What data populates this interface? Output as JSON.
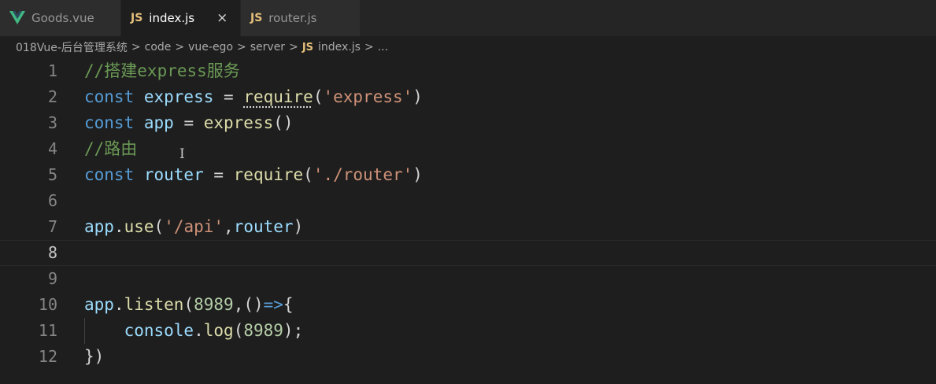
{
  "tabs": [
    {
      "label": "Goods.vue",
      "icon": "vue-icon",
      "active": false
    },
    {
      "label": "index.js",
      "icon": "js-icon",
      "active": true,
      "close": "×"
    },
    {
      "label": "router.js",
      "icon": "js-icon",
      "active": false
    }
  ],
  "js_badge": "JS",
  "breadcrumb": {
    "items": [
      "018Vue-后台管理系统",
      "code",
      "vue-ego",
      "server",
      "index.js",
      "..."
    ],
    "separator": ">"
  },
  "editor": {
    "current_line": 8,
    "lines": [
      {
        "num": "1",
        "tokens": [
          {
            "t": "//搭建express服务",
            "c": "comment"
          }
        ]
      },
      {
        "num": "2",
        "tokens": [
          {
            "t": "const ",
            "c": "keyword"
          },
          {
            "t": "express",
            "c": "var"
          },
          {
            "t": " = ",
            "c": "punct"
          },
          {
            "t": "require",
            "c": "req"
          },
          {
            "t": "(",
            "c": "punct"
          },
          {
            "t": "'express'",
            "c": "str"
          },
          {
            "t": ")",
            "c": "punct"
          }
        ]
      },
      {
        "num": "3",
        "tokens": [
          {
            "t": "const ",
            "c": "keyword"
          },
          {
            "t": "app",
            "c": "var"
          },
          {
            "t": " = ",
            "c": "punct"
          },
          {
            "t": "express",
            "c": "fn"
          },
          {
            "t": "()",
            "c": "punct"
          }
        ]
      },
      {
        "num": "4",
        "tokens": [
          {
            "t": "//路由",
            "c": "comment"
          }
        ]
      },
      {
        "num": "5",
        "tokens": [
          {
            "t": "const ",
            "c": "keyword"
          },
          {
            "t": "router",
            "c": "var"
          },
          {
            "t": " = ",
            "c": "punct"
          },
          {
            "t": "require",
            "c": "fn"
          },
          {
            "t": "(",
            "c": "punct"
          },
          {
            "t": "'./router'",
            "c": "str"
          },
          {
            "t": ")",
            "c": "punct"
          }
        ]
      },
      {
        "num": "6",
        "tokens": []
      },
      {
        "num": "7",
        "tokens": [
          {
            "t": "app",
            "c": "var"
          },
          {
            "t": ".",
            "c": "punct"
          },
          {
            "t": "use",
            "c": "fn"
          },
          {
            "t": "(",
            "c": "punct"
          },
          {
            "t": "'/api'",
            "c": "str"
          },
          {
            "t": ",",
            "c": "punct"
          },
          {
            "t": "router",
            "c": "var"
          },
          {
            "t": ")",
            "c": "punct"
          }
        ]
      },
      {
        "num": "8",
        "tokens": []
      },
      {
        "num": "9",
        "tokens": []
      },
      {
        "num": "10",
        "tokens": [
          {
            "t": "app",
            "c": "var"
          },
          {
            "t": ".",
            "c": "punct"
          },
          {
            "t": "listen",
            "c": "fn"
          },
          {
            "t": "(",
            "c": "punct"
          },
          {
            "t": "8989",
            "c": "num"
          },
          {
            "t": ",()",
            "c": "punct"
          },
          {
            "t": "=>",
            "c": "keyword"
          },
          {
            "t": "{",
            "c": "punct"
          }
        ]
      },
      {
        "num": "11",
        "indent": true,
        "tokens": [
          {
            "t": "    ",
            "c": "punct"
          },
          {
            "t": "console",
            "c": "var"
          },
          {
            "t": ".",
            "c": "punct"
          },
          {
            "t": "log",
            "c": "fn"
          },
          {
            "t": "(",
            "c": "punct"
          },
          {
            "t": "8989",
            "c": "num"
          },
          {
            "t": ");",
            "c": "punct"
          }
        ]
      },
      {
        "num": "12",
        "tokens": [
          {
            "t": "})",
            "c": "punct"
          }
        ]
      }
    ]
  },
  "colors": {
    "comment": "#6a9955",
    "keyword": "#569cd6",
    "variable": "#9cdcfe",
    "function": "#dcdcaa",
    "string": "#ce9178",
    "number": "#b5cea8"
  },
  "mouse_cursor": "text-cursor-icon"
}
